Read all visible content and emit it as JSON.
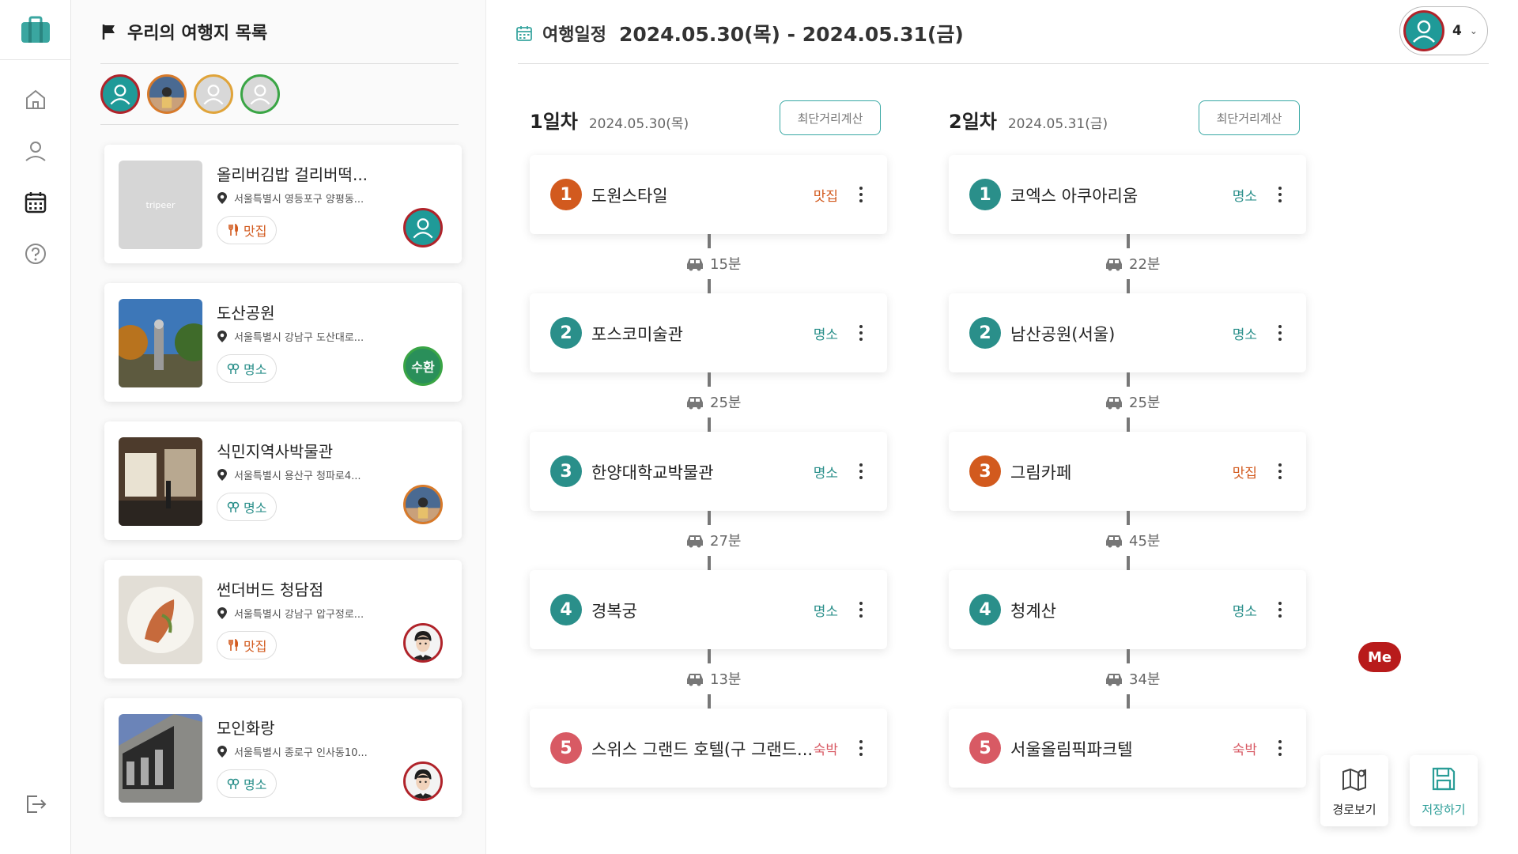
{
  "list": {
    "title": "우리의 여행지 목록",
    "members": [
      {
        "icon": "user-silhouette-icon",
        "ring": "#b0232a",
        "bg": "#1f9a98"
      },
      {
        "icon": "photo-avatar-icon",
        "ring": "#d87a2a",
        "bg": "#6a7e96"
      },
      {
        "icon": "user-silhouette-icon",
        "ring": "#e0a43a",
        "bg": "#d8d8d8"
      },
      {
        "icon": "user-silhouette-icon",
        "ring": "#3aa545",
        "bg": "#d8d8d8"
      }
    ],
    "cards": [
      {
        "name": "올리버김밥 걸리버떡...",
        "address": "서울특별시 영등포구 양평동...",
        "tag": "맛집",
        "tag_icon": "utensils-icon",
        "tag_color": "#d25a1e",
        "thumb_text": "tripeer",
        "avatar_text": "",
        "avatar_ring": "#b0232a",
        "avatar_bg": "#1f9a98"
      },
      {
        "name": "도산공원",
        "address": "서울특별시 강남구 도산대로...",
        "tag": "명소",
        "tag_icon": "landmark-icon",
        "tag_color": "#2a8f8a",
        "thumb_text": "",
        "avatar_text": "수환",
        "avatar_ring": "#3aa545",
        "avatar_bg": "#2a8f5a"
      },
      {
        "name": "식민지역사박물관",
        "address": "서울특별시 용산구 청파로4...",
        "tag": "명소",
        "tag_icon": "landmark-icon",
        "tag_color": "#2a8f8a",
        "thumb_text": "",
        "avatar_text": "",
        "avatar_ring": "#d87a2a",
        "avatar_bg": "#6a7e96"
      },
      {
        "name": "썬더버드 청담점",
        "address": "서울특별시 강남구 압구정로...",
        "tag": "맛집",
        "tag_icon": "utensils-icon",
        "tag_color": "#d25a1e",
        "thumb_text": "",
        "avatar_text": "",
        "avatar_ring": "#b0232a",
        "avatar_bg": "#f3f3f3"
      },
      {
        "name": "모인화랑",
        "address": "서울특별시 종로구 인사동10...",
        "tag": "명소",
        "tag_icon": "landmark-icon",
        "tag_color": "#2a8f8a",
        "thumb_text": "",
        "avatar_text": "",
        "avatar_ring": "#b0232a",
        "avatar_bg": "#f3f3f3"
      }
    ]
  },
  "schedule": {
    "label": "여행일정",
    "dates": "2024.05.30(목) - 2024.05.31(금)",
    "user_count": "4",
    "calc_label": "최단거리계산",
    "days": [
      {
        "title": "1일차",
        "date": "2024.05.30(목)",
        "stops": [
          {
            "num": "1",
            "name": "도원스타일",
            "cat": "맛집",
            "color": "#d25a1e"
          },
          {
            "num": "2",
            "name": "포스코미술관",
            "cat": "명소",
            "color": "#2a8f8a"
          },
          {
            "num": "3",
            "name": "한양대학교박물관",
            "cat": "명소",
            "color": "#2a8f8a"
          },
          {
            "num": "4",
            "name": "경복궁",
            "cat": "명소",
            "color": "#2a8f8a"
          },
          {
            "num": "5",
            "name": "스위스 그랜드 호텔(구 그랜드...",
            "cat": "숙박",
            "color": "#d85a64"
          }
        ],
        "travel": [
          "15분",
          "25분",
          "27분",
          "13분"
        ]
      },
      {
        "title": "2일차",
        "date": "2024.05.31(금)",
        "stops": [
          {
            "num": "1",
            "name": "코엑스 아쿠아리움",
            "cat": "명소",
            "color": "#2a8f8a"
          },
          {
            "num": "2",
            "name": "남산공원(서울)",
            "cat": "명소",
            "color": "#2a8f8a"
          },
          {
            "num": "3",
            "name": "그림카페",
            "cat": "맛집",
            "color": "#d25a1e"
          },
          {
            "num": "4",
            "name": "청계산",
            "cat": "명소",
            "color": "#2a8f8a"
          },
          {
            "num": "5",
            "name": "서울올림픽파크텔",
            "cat": "숙박",
            "color": "#d85a64"
          }
        ],
        "travel": [
          "22분",
          "25분",
          "45분",
          "34분"
        ]
      }
    ]
  },
  "me_badge": "Me",
  "actions": {
    "route": "경로보기",
    "save": "저장하기",
    "save_color": "#2a9d97"
  }
}
